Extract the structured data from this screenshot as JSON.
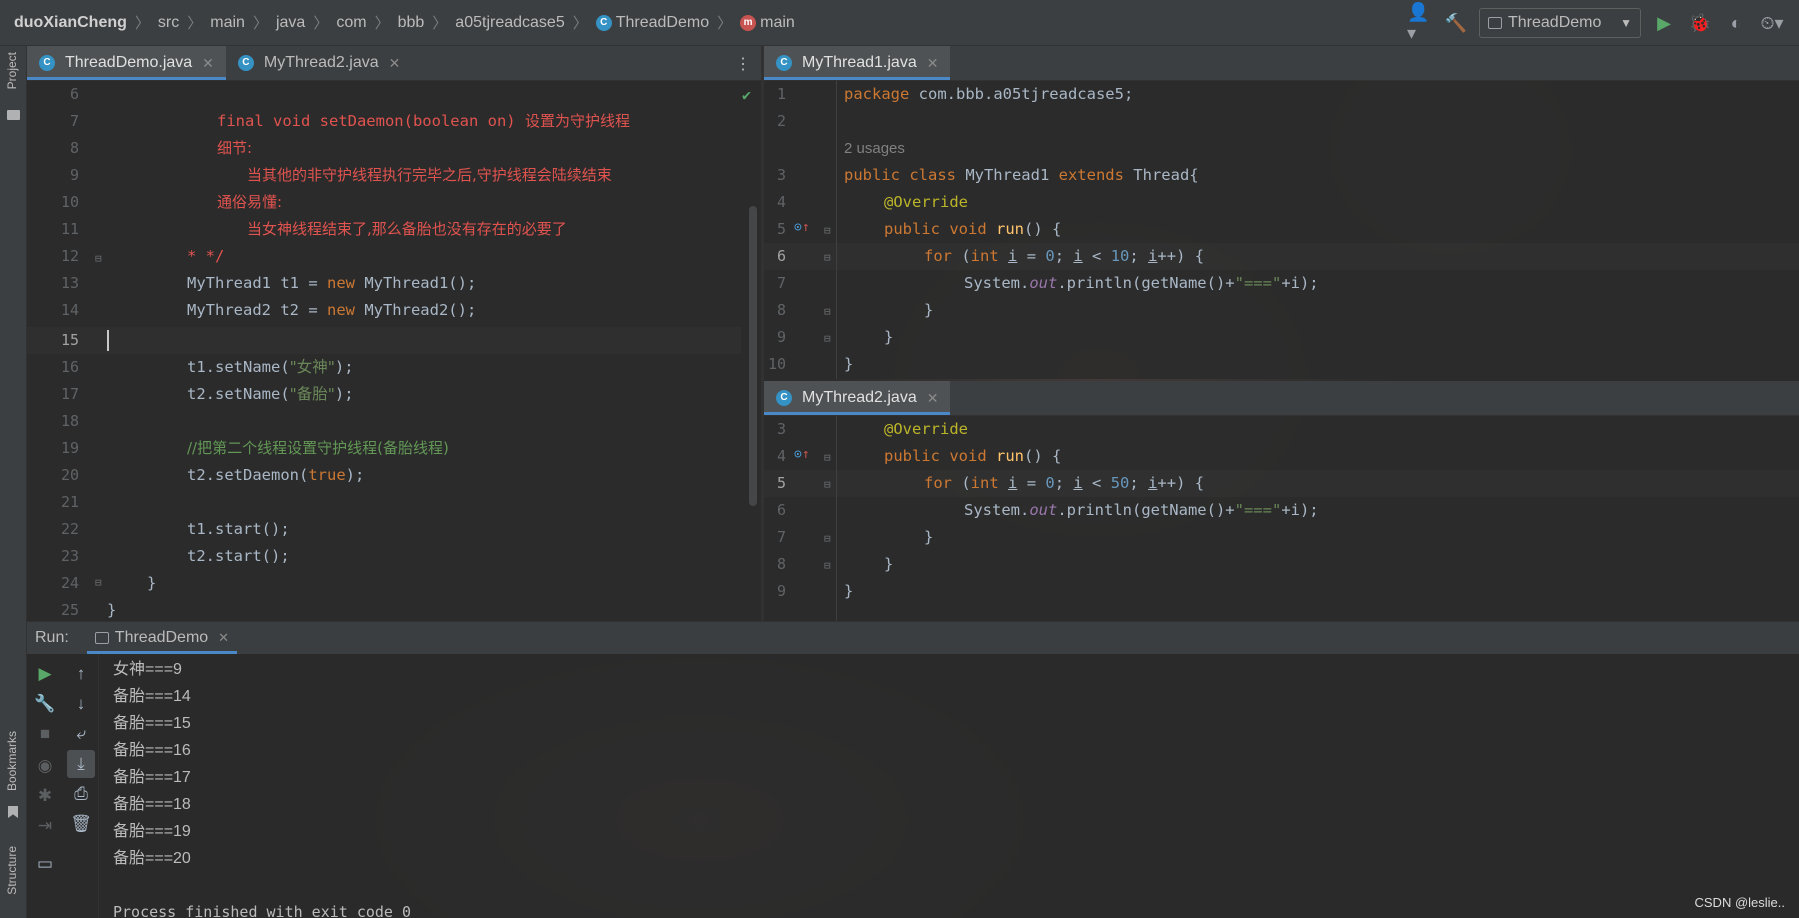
{
  "breadcrumb": {
    "items": [
      "duoXianCheng",
      "src",
      "main",
      "java",
      "com",
      "bbb",
      "a05tjreadcase5",
      "ThreadDemo",
      "main"
    ]
  },
  "toolbar": {
    "run_config": "ThreadDemo"
  },
  "left_stripe": {
    "project": "Project",
    "bookmarks": "Bookmarks",
    "structure": "Structure"
  },
  "left_editor": {
    "tabs": [
      "ThreadDemo.java",
      "MyThread2.java"
    ],
    "line_numbers": [
      "6",
      "7",
      "8",
      "9",
      "10",
      "11",
      "12",
      "13",
      "14",
      "15",
      "16",
      "17",
      "18",
      "19",
      "20",
      "21",
      "22",
      "23",
      "24",
      "25"
    ],
    "current_line": "15",
    "lines": {
      "l7_a": "final void setDaemon(boolean on) ",
      "l7_b": "设置为守护线程",
      "l8": "细节:",
      "l9": "当其他的非守护线程执行完毕之后,守护线程会陆续结束",
      "l10": "通俗易懂:",
      "l11": "当女神线程结束了,那么备胎也没有存在的必要了",
      "l12": "* */",
      "l13_a": "MyThread1 t1 = ",
      "l13_kw": "new",
      "l13_b": " MyThread1();",
      "l14_a": "MyThread2 t2 = ",
      "l14_kw": "new",
      "l14_b": " MyThread2();",
      "l16_a": "t1.setName(",
      "l16_s": "\"女神\"",
      "l16_b": ");",
      "l17_a": "t2.setName(",
      "l17_s": "\"备胎\"",
      "l17_b": ");",
      "l19": "//把第二个线程设置守护线程(备胎线程)",
      "l20_a": "t2.setDaemon(",
      "l20_kw": "true",
      "l20_b": ");",
      "l22": "t1.start();",
      "l23": "t2.start();",
      "l24": "}",
      "l25": "}"
    }
  },
  "right_top_editor": {
    "tab": "MyThread1.java",
    "line_numbers": [
      "1",
      "2",
      "3",
      "4",
      "5",
      "6",
      "7",
      "8",
      "9",
      "10"
    ],
    "current_line": "6",
    "usages": "2 usages",
    "package_kw": "package",
    "package_name": " com.bbb.a05tjreadcase5;",
    "class_kw1": "public class",
    "class_name": " MyThread1 ",
    "class_kw2": "extends",
    "class_rest": " Thread{",
    "override": "@Override",
    "run_kw": "public void",
    "run_fn": "run",
    "run_rest": "() {",
    "for_kw": "for",
    "int_kw": "int",
    "loop_var": "i",
    "limit": "10",
    "println_a": "System.",
    "println_out": "out",
    "println_b": ".println(getName()+",
    "println_str": "\"===\"",
    "println_c": "+i);",
    "close1": "}",
    "close2": "}",
    "close3": "}"
  },
  "right_bottom_editor": {
    "tab": "MyThread2.java",
    "line_numbers": [
      "3",
      "4",
      "5",
      "6",
      "7",
      "8",
      "9"
    ],
    "current_line": "5",
    "limit": "50"
  },
  "run_panel": {
    "label": "Run:",
    "tab": "ThreadDemo",
    "output": [
      "女神===9",
      "备胎===14",
      "备胎===15",
      "备胎===16",
      "备胎===17",
      "备胎===18",
      "备胎===19",
      "备胎===20",
      "",
      "Process finished with exit code 0"
    ]
  },
  "watermark": "CSDN @leslie.."
}
